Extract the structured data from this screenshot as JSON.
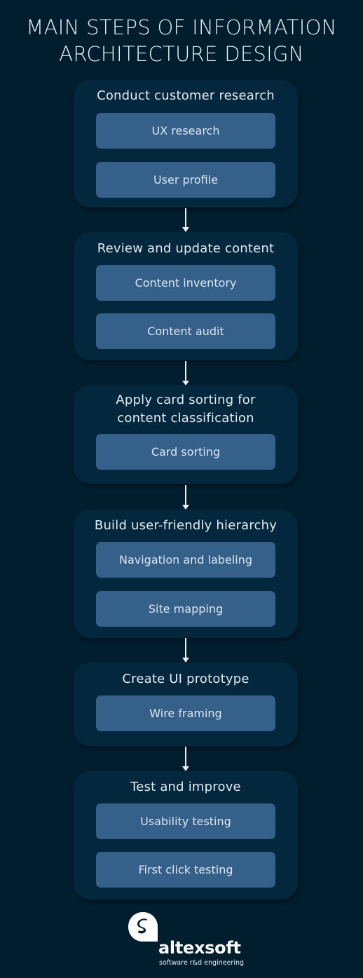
{
  "title": {
    "line1": "MAIN STEPS OF INFORMATION",
    "line2": "ARCHITECTURE DESIGN"
  },
  "colors": {
    "background": "#011e2f",
    "step_box": "#03283d",
    "sub_box": "#35608a",
    "text": "#e2ebf3",
    "arrow": "#e8eef4"
  },
  "steps": [
    {
      "title": "Conduct customer research",
      "items": [
        "UX research",
        "User profile"
      ]
    },
    {
      "title": "Review and update content",
      "items": [
        "Content inventory",
        "Content audit"
      ]
    },
    {
      "title_line1": "Apply card sorting for",
      "title_line2": "content classification",
      "items": [
        "Card sorting"
      ]
    },
    {
      "title": "Build user-friendly hierarchy",
      "items": [
        "Navigation and labeling",
        "Site mapping"
      ]
    },
    {
      "title": "Create UI prototype",
      "items": [
        "Wire framing"
      ]
    },
    {
      "title": "Test and improve",
      "items": [
        "Usability testing",
        "First click testing"
      ]
    }
  ],
  "logo": {
    "icon": "altexsoft-logo-icon",
    "name": "altexsoft",
    "tagline": "software r&d engineering"
  }
}
